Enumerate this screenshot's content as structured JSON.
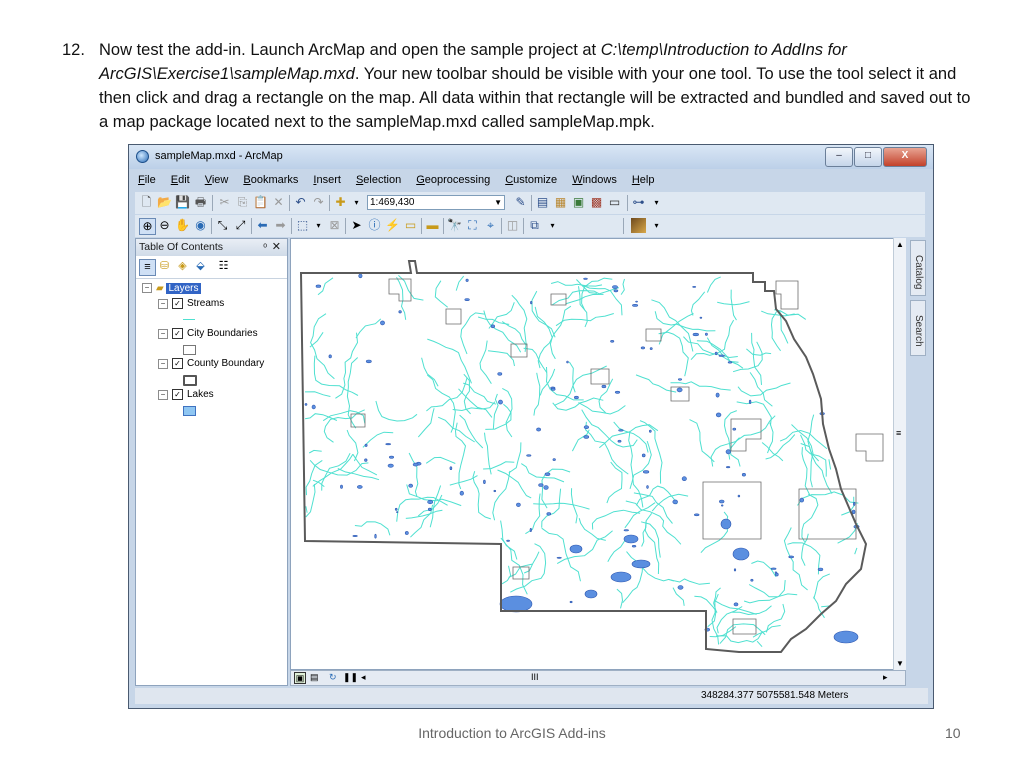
{
  "slide": {
    "number": "12.",
    "text_a": "Now test the add-in.  Launch ArcMap and open the sample project at ",
    "path": "C:\\temp\\Introduction to AddIns for ArcGIS\\Exercise1\\sampleMap.mxd",
    "text_b": ".  Your new toolbar should be visible with your one tool.  To use the tool select it and then click and drag a rectangle on the map.  All data within that rectangle will be extracted and bundled and saved out to a map package located next to the sampleMap.mxd called sampleMap.mpk.",
    "footer": "Introduction to ArcGIS Add-ins",
    "page": "10"
  },
  "window": {
    "title": "sampleMap.mxd - ArcMap",
    "minimize": "–",
    "maximize": "□",
    "close": "X"
  },
  "menu": [
    "File",
    "Edit",
    "View",
    "Bookmarks",
    "Insert",
    "Selection",
    "Geoprocessing",
    "Customize",
    "Windows",
    "Help"
  ],
  "toolbar": {
    "scale": "1:469,430"
  },
  "toc": {
    "title": "Table Of Contents",
    "root": "Layers",
    "layers": [
      {
        "name": "Streams",
        "symbol": "line",
        "color": "#4fe0d0"
      },
      {
        "name": "City Boundaries",
        "symbol": "fill",
        "color": "#ffffff"
      },
      {
        "name": "County Boundary",
        "symbol": "outline",
        "color": "#555555"
      },
      {
        "name": "Lakes",
        "symbol": "fill",
        "color": "#8fc6f2"
      }
    ]
  },
  "side_tabs": {
    "catalog": "Catalog",
    "search": "Search"
  },
  "scrollbar": {
    "thumb": "III"
  },
  "status": {
    "coordinates": "348284.377  5075581.548 Meters"
  },
  "colors": {
    "streams": "#4fe0d0",
    "lakes": "#5b8fe0",
    "county": "#5a5a5a",
    "cities": "#6b6b6b"
  }
}
